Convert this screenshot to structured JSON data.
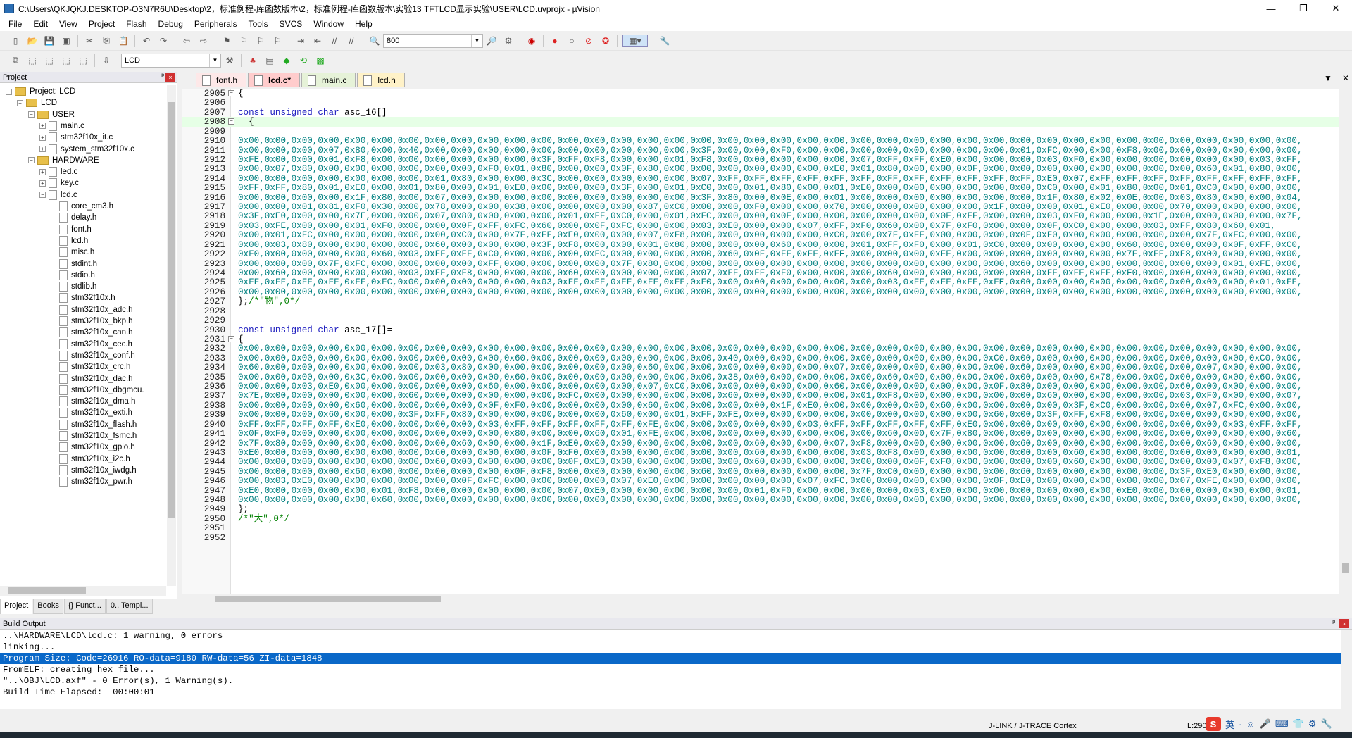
{
  "window": {
    "title": "C:\\Users\\QKJQKJ.DESKTOP-O3N7R6U\\Desktop\\2，标准例程-库函数版本\\2，标准例程-库函数版本\\实验13 TFTLCD显示实验\\USER\\LCD.uvprojx - µVision",
    "minimize": "—",
    "restore": "❐",
    "close": "✕"
  },
  "menu": [
    "File",
    "Edit",
    "View",
    "Project",
    "Flash",
    "Debug",
    "Peripherals",
    "Tools",
    "SVCS",
    "Window",
    "Help"
  ],
  "toolbar": {
    "find_value": "800",
    "target_value": "LCD"
  },
  "project_panel": {
    "title": "Project",
    "pin": "ᵖ",
    "close": "×",
    "tree": [
      {
        "label": "Project: LCD",
        "level": 0,
        "kind": "root",
        "exp": "−"
      },
      {
        "label": "LCD",
        "level": 1,
        "kind": "folder",
        "exp": "−"
      },
      {
        "label": "USER",
        "level": 2,
        "kind": "folder",
        "exp": "−"
      },
      {
        "label": "main.c",
        "level": 3,
        "kind": "file",
        "exp": "+"
      },
      {
        "label": "stm32f10x_it.c",
        "level": 3,
        "kind": "file",
        "exp": "+"
      },
      {
        "label": "system_stm32f10x.c",
        "level": 3,
        "kind": "file",
        "exp": "+"
      },
      {
        "label": "HARDWARE",
        "level": 2,
        "kind": "folder",
        "exp": "−"
      },
      {
        "label": "led.c",
        "level": 3,
        "kind": "file",
        "exp": "+"
      },
      {
        "label": "key.c",
        "level": 3,
        "kind": "file",
        "exp": "+"
      },
      {
        "label": "lcd.c",
        "level": 3,
        "kind": "file",
        "exp": "−"
      },
      {
        "label": "core_cm3.h",
        "level": 4,
        "kind": "file"
      },
      {
        "label": "delay.h",
        "level": 4,
        "kind": "file"
      },
      {
        "label": "font.h",
        "level": 4,
        "kind": "file"
      },
      {
        "label": "lcd.h",
        "level": 4,
        "kind": "file"
      },
      {
        "label": "misc.h",
        "level": 4,
        "kind": "file"
      },
      {
        "label": "stdint.h",
        "level": 4,
        "kind": "file"
      },
      {
        "label": "stdio.h",
        "level": 4,
        "kind": "file"
      },
      {
        "label": "stdlib.h",
        "level": 4,
        "kind": "file"
      },
      {
        "label": "stm32f10x.h",
        "level": 4,
        "kind": "file"
      },
      {
        "label": "stm32f10x_adc.h",
        "level": 4,
        "kind": "file"
      },
      {
        "label": "stm32f10x_bkp.h",
        "level": 4,
        "kind": "file"
      },
      {
        "label": "stm32f10x_can.h",
        "level": 4,
        "kind": "file"
      },
      {
        "label": "stm32f10x_cec.h",
        "level": 4,
        "kind": "file"
      },
      {
        "label": "stm32f10x_conf.h",
        "level": 4,
        "kind": "file"
      },
      {
        "label": "stm32f10x_crc.h",
        "level": 4,
        "kind": "file"
      },
      {
        "label": "stm32f10x_dac.h",
        "level": 4,
        "kind": "file"
      },
      {
        "label": "stm32f10x_dbgmcu.",
        "level": 4,
        "kind": "file"
      },
      {
        "label": "stm32f10x_dma.h",
        "level": 4,
        "kind": "file"
      },
      {
        "label": "stm32f10x_exti.h",
        "level": 4,
        "kind": "file"
      },
      {
        "label": "stm32f10x_flash.h",
        "level": 4,
        "kind": "file"
      },
      {
        "label": "stm32f10x_fsmc.h",
        "level": 4,
        "kind": "file"
      },
      {
        "label": "stm32f10x_gpio.h",
        "level": 4,
        "kind": "file"
      },
      {
        "label": "stm32f10x_i2c.h",
        "level": 4,
        "kind": "file"
      },
      {
        "label": "stm32f10x_iwdg.h",
        "level": 4,
        "kind": "file"
      },
      {
        "label": "stm32f10x_pwr.h",
        "level": 4,
        "kind": "file"
      }
    ],
    "tabs": [
      {
        "label": "Project",
        "active": true
      },
      {
        "label": "Books",
        "active": false
      },
      {
        "label": "{} Funct...",
        "active": false
      },
      {
        "label": "0.. Templ...",
        "active": false
      }
    ]
  },
  "editor": {
    "tabs": [
      "font.h",
      "lcd.c*",
      "main.c",
      "lcd.h"
    ],
    "active_tab": 1,
    "controls": [
      "▼",
      "✕"
    ],
    "lines": [
      {
        "n": "2905",
        "fold": "−",
        "parts": [
          [
            "t",
            "{"
          ]
        ]
      },
      {
        "n": "2906",
        "parts": []
      },
      {
        "n": "2907",
        "parts": [
          [
            "k",
            "const unsigned char"
          ],
          [
            "t",
            " asc_16[]="
          ]
        ]
      },
      {
        "n": "2908",
        "fold": "−",
        "hl": true,
        "parts": [
          [
            "t",
            "  {"
          ]
        ]
      },
      {
        "n": "2909",
        "parts": []
      },
      {
        "n": "2910",
        "parts": [
          [
            "h",
            "0x00,0x00,0x00,0x00,0x00,0x00,0x00,0x00,0x00,0x00,0x00,0x00,0x00,0x00,0x00,0x00,0x00,0x00,0x00,0x00,0x00,0x00,0x00,0x00,0x00,0x00,0x00,0x00,0x00,0x00,0x00,0x00,0x00,0x00,0x00,0x00,0x00,0x00,0x00,0x00,"
          ]
        ]
      },
      {
        "n": "2911",
        "parts": [
          [
            "h",
            "0x00,0x00,0x00,0x07,0x80,0x00,0x40,0x00,0x00,0x00,0x00,0x00,0x00,0x00,0x00,0x00,0x00,0x3F,0x00,0x00,0xF0,0x00,0x00,0x00,0x00,0x00,0x00,0x00,0x00,0x01,0xFC,0x00,0x00,0xF8,0x00,0x00,0x00,0x00,0x00,0x00,"
          ]
        ]
      },
      {
        "n": "2912",
        "parts": [
          [
            "h",
            "0xFE,0x00,0x00,0x01,0xF8,0x00,0x00,0x00,0x00,0x00,0x00,0x3F,0xFF,0xF8,0x00,0x00,0x01,0xF8,0x00,0x00,0x00,0x00,0x00,0x07,0xFF,0xFF,0xE0,0x00,0x00,0x00,0x03,0xF0,0x00,0x00,0x00,0x00,0x00,0x00,0x03,0xFF,"
          ]
        ]
      },
      {
        "n": "2913",
        "parts": [
          [
            "h",
            "0x00,0x07,0x80,0x00,0x00,0x00,0x00,0x00,0x00,0xF0,0x01,0x80,0x00,0x00,0x0F,0x80,0x00,0x00,0x00,0x00,0x00,0x00,0xE0,0x01,0x80,0x00,0x00,0x0F,0x00,0x00,0x00,0x00,0x00,0x00,0x00,0x00,0x60,0x01,0x80,0x00,"
          ]
        ]
      },
      {
        "n": "2914",
        "parts": [
          [
            "h",
            "0x00,0x00,0x00,0x00,0x00,0x00,0x00,0x01,0x80,0x00,0x00,0x3C,0x00,0x00,0x00,0x00,0x00,0x07,0xFF,0xFF,0xFF,0xFF,0xFF,0xFF,0xFF,0xFF,0xFF,0xFF,0xFF,0xFF,0xE0,0x07,0xFF,0xFF,0xFF,0xFF,0xFF,0xFF,0xFF,0xFF,"
          ]
        ]
      },
      {
        "n": "2915",
        "parts": [
          [
            "h",
            "0xFF,0xFF,0x80,0x01,0xE0,0x00,0x01,0x80,0x00,0x01,0xE0,0x00,0x00,0x00,0x3F,0x00,0x01,0xC0,0x00,0x01,0x80,0x00,0x01,0xE0,0x00,0x00,0x00,0x00,0x00,0x00,0xC0,0x00,0x01,0x80,0x00,0x01,0xC0,0x00,0x00,0x00,"
          ]
        ]
      },
      {
        "n": "2916",
        "parts": [
          [
            "h",
            "0x00,0x00,0x00,0x00,0x1F,0x80,0x00,0x07,0x00,0x00,0x00,0x00,0x00,0x00,0x00,0x00,0x00,0x3F,0x80,0x00,0x0E,0x00,0x01,0x00,0x00,0x00,0x00,0x00,0x00,0x00,0x1F,0x80,0x02,0x0E,0x00,0x03,0x80,0x00,0x00,0x04,"
          ]
        ]
      },
      {
        "n": "2917",
        "parts": [
          [
            "h",
            "0x00,0x00,0x01,0x81,0xF0,0x30,0x00,0x78,0x00,0x00,0x38,0x00,0x00,0x00,0x00,0x87,0xC0,0x00,0x00,0xF0,0x00,0x00,0x70,0x00,0x00,0x00,0x00,0x00,0x1F,0x80,0x00,0x01,0xE0,0x00,0x00,0x70,0x00,0x00,0x00,0x00,"
          ]
        ]
      },
      {
        "n": "2918",
        "parts": [
          [
            "h",
            "0x3F,0xE0,0x00,0x00,0x7E,0x00,0x00,0x07,0x80,0x00,0x00,0x00,0x01,0xFF,0xC0,0x00,0x01,0xFC,0x00,0x00,0x0F,0x00,0x00,0x00,0x00,0x00,0x0F,0xFF,0x00,0x00,0x03,0xF0,0x00,0x00,0x1E,0x00,0x00,0x00,0x00,0x7F,"
          ]
        ]
      },
      {
        "n": "2919",
        "parts": [
          [
            "h",
            "0x03,0xFE,0x00,0x00,0x01,0xF0,0x00,0x00,0x0F,0xFF,0xFC,0x60,0x00,0x0F,0xFC,0x00,0x00,0x03,0xE0,0x00,0x00,0x07,0xFF,0xF0,0x60,0x00,0x7F,0xF0,0x00,0x00,0x0F,0xC0,0x00,0x00,0x03,0xFF,0x80,0x60,0x01,"
          ]
        ]
      },
      {
        "n": "2920",
        "parts": [
          [
            "h",
            "0x00,0x01,0xFC,0x00,0x00,0x00,0x00,0x00,0xC0,0x00,0x7F,0xFF,0xE0,0x00,0x00,0x07,0xF8,0x00,0x00,0x00,0x00,0x00,0xC0,0x00,0x7F,0xFF,0x00,0x00,0x00,0x0F,0xF0,0x00,0x00,0x00,0x00,0x00,0x7F,0xFC,0x00,0x00,"
          ]
        ]
      },
      {
        "n": "2921",
        "parts": [
          [
            "h",
            "0x00,0x03,0x80,0x00,0x00,0x00,0x00,0x60,0x00,0x00,0x00,0x3F,0xF8,0x00,0x00,0x01,0x80,0x00,0x00,0x00,0x60,0x00,0x00,0x01,0xFF,0xF0,0x00,0x01,0xC0,0x00,0x00,0x00,0x00,0x60,0x00,0x00,0x00,0x0F,0xFF,0xC0,"
          ]
        ]
      },
      {
        "n": "2922",
        "parts": [
          [
            "h",
            "0xF0,0x00,0x00,0x00,0x00,0x60,0x03,0xFF,0xFF,0xC0,0x00,0x00,0x00,0xFC,0x00,0x00,0x00,0x00,0x60,0x0F,0xFF,0xFF,0xFE,0x00,0x00,0x00,0xFF,0x00,0x00,0x00,0x00,0x00,0x00,0x7F,0xFF,0xF8,0x00,0x00,0x00,0x00,"
          ]
        ]
      },
      {
        "n": "2923",
        "parts": [
          [
            "h",
            "0x00,0x00,0x00,0x7F,0xFC,0x00,0x00,0x00,0x00,0xFF,0x00,0x00,0x00,0x00,0x7F,0x80,0x00,0x00,0x00,0x00,0x00,0x00,0x00,0x00,0x00,0x00,0x00,0x00,0x00,0x60,0x00,0x00,0x00,0x00,0x00,0x00,0x00,0x01,0xFE,0x00,"
          ]
        ]
      },
      {
        "n": "2924",
        "parts": [
          [
            "h",
            "0x00,0x60,0x00,0x00,0x00,0x00,0x03,0xFF,0xF8,0x00,0x00,0x00,0x60,0x00,0x00,0x00,0x00,0x07,0xFF,0xFF,0xF0,0x00,0x00,0x00,0x60,0x00,0x00,0x00,0x00,0x00,0xFF,0xFF,0xFF,0xE0,0x00,0x00,0x00,0x00,0x00,0x00,"
          ]
        ]
      },
      {
        "n": "2925",
        "parts": [
          [
            "h",
            "0xFF,0xFF,0xFF,0xFF,0xFF,0xFC,0x00,0x00,0x00,0x00,0x00,0x03,0xFF,0xFF,0xFF,0xFF,0xFF,0xF0,0x00,0x00,0x00,0x00,0x00,0x00,0x03,0xFF,0xFF,0xFF,0xFE,0x00,0x00,0x00,0x00,0x00,0x00,0x00,0x00,0x00,0x01,0xFF,"
          ]
        ]
      },
      {
        "n": "2926",
        "parts": [
          [
            "h",
            "0x00,0x00,0x00,0x00,0x00,0x00,0x00,0x00,0x00,0x00,0x00,0x00,0x00,0x00,0x00,0x00,0x00,0x00,0x00,0x00,0x00,0x00,0x00,0x00,0x00,0x00,0x00,0x00,0x00,0x00,0x00,0x00,0x00,0x00,0x00,0x00,0x00,0x00,0x00,0x00,"
          ]
        ]
      },
      {
        "n": "2927",
        "parts": [
          [
            "t",
            "};"
          ],
          [
            "c",
            "/*\"物\",0*/"
          ]
        ]
      },
      {
        "n": "2928",
        "parts": []
      },
      {
        "n": "2929",
        "parts": []
      },
      {
        "n": "2930",
        "parts": [
          [
            "k",
            "const unsigned char"
          ],
          [
            "t",
            " asc_17[]="
          ]
        ]
      },
      {
        "n": "2931",
        "fold": "−",
        "parts": [
          [
            "t",
            "{"
          ]
        ]
      },
      {
        "n": "2932",
        "parts": [
          [
            "h",
            "0x00,0x00,0x00,0x00,0x00,0x00,0x00,0x00,0x00,0x00,0x00,0x00,0x00,0x00,0x00,0x00,0x00,0x00,0x00,0x00,0x00,0x00,0x00,0x00,0x00,0x00,0x00,0x00,0x00,0x00,0x00,0x00,0x00,0x00,0x00,0x00,0x00,0x00,0x00,0x00,"
          ]
        ]
      },
      {
        "n": "2933",
        "parts": [
          [
            "h",
            "0x00,0x00,0x00,0x00,0x00,0x00,0x00,0x00,0x00,0x00,0x60,0x00,0x00,0x00,0x00,0x00,0x00,0x00,0x40,0x00,0x00,0x00,0x00,0x00,0x00,0x00,0x00,0x00,0xC0,0x00,0x00,0x00,0x00,0x00,0x00,0x00,0x00,0x00,0xC0,0x00,"
          ]
        ]
      },
      {
        "n": "2934",
        "parts": [
          [
            "h",
            "0x60,0x00,0x00,0x00,0x00,0x00,0x00,0x03,0x80,0x00,0x00,0x00,0x00,0x00,0x00,0x60,0x00,0x00,0x00,0x00,0x00,0x00,0x07,0x00,0x00,0x00,0x00,0x00,0x00,0x60,0x00,0x00,0x00,0x00,0x00,0x00,0x07,0x00,0x00,0x00,"
          ]
        ]
      },
      {
        "n": "2935",
        "parts": [
          [
            "h",
            "0x00,0x00,0x00,0x00,0x3C,0x00,0x00,0x00,0x00,0x00,0x60,0x00,0x00,0x00,0x00,0x00,0x00,0x00,0x38,0x00,0x00,0x00,0x00,0x00,0x60,0x00,0x00,0x00,0x00,0x00,0x00,0x00,0x78,0x00,0x00,0x00,0x00,0x00,0x60,0x00,"
          ]
        ]
      },
      {
        "n": "2936",
        "parts": [
          [
            "h",
            "0x00,0x00,0x03,0xE0,0x00,0x00,0x00,0x00,0x00,0x60,0x00,0x00,0x00,0x00,0x00,0x07,0xC0,0x00,0x00,0x00,0x00,0x00,0x60,0x00,0x00,0x00,0x00,0x00,0x0F,0x80,0x00,0x00,0x00,0x00,0x00,0x60,0x00,0x00,0x00,0x00,"
          ]
        ]
      },
      {
        "n": "2937",
        "parts": [
          [
            "h",
            "0x7E,0x00,0x00,0x00,0x00,0x00,0x60,0x00,0x00,0x00,0x00,0x00,0xFC,0x00,0x00,0x00,0x00,0x00,0x60,0x00,0x00,0x00,0x00,0x01,0xF8,0x00,0x00,0x00,0x00,0x00,0x60,0x00,0x00,0x00,0x00,0x03,0xF0,0x00,0x00,0x07,"
          ]
        ]
      },
      {
        "n": "2938",
        "parts": [
          [
            "h",
            "0x00,0x00,0x00,0x00,0x60,0x00,0x00,0x00,0x00,0x0F,0xF0,0x00,0x00,0x00,0x00,0x60,0x00,0x00,0x00,0x00,0x1F,0xE0,0x00,0x00,0x00,0x00,0x60,0x00,0x00,0x00,0x00,0x3F,0xC0,0x00,0x00,0x00,0x07,0xFC,0x00,0x00,"
          ]
        ]
      },
      {
        "n": "2939",
        "parts": [
          [
            "h",
            "0x00,0x00,0x00,0x60,0x00,0x00,0x3F,0xFF,0x80,0x00,0x00,0x00,0x00,0x00,0x60,0x00,0x01,0xFF,0xFE,0x00,0x00,0x00,0x00,0x00,0x00,0x00,0x00,0x00,0x60,0x00,0x3F,0xFF,0xF8,0x00,0x00,0x00,0x00,0x00,0x00,0x00,"
          ]
        ]
      },
      {
        "n": "2940",
        "parts": [
          [
            "h",
            "0xFF,0xFF,0xFF,0xFF,0xE0,0x00,0x00,0x00,0x00,0x03,0xFF,0xFF,0xFF,0xFF,0xFF,0xFE,0x00,0x00,0x00,0x00,0x00,0x03,0xFF,0xFF,0xFF,0xFF,0xFF,0xE0,0x00,0x00,0x00,0x00,0x00,0x00,0x00,0x00,0x00,0x03,0xFF,0xFF,"
          ]
        ]
      },
      {
        "n": "2941",
        "parts": [
          [
            "h",
            "0x0F,0xF0,0x00,0x00,0x00,0x00,0x00,0x00,0x00,0x00,0x80,0x00,0x00,0x60,0x01,0xFE,0x00,0x00,0x00,0x00,0x00,0x00,0x00,0x00,0x60,0x00,0x7F,0x80,0x00,0x00,0x00,0x00,0x00,0x00,0x00,0x00,0x00,0x00,0x00,0x60,"
          ]
        ]
      },
      {
        "n": "2942",
        "parts": [
          [
            "h",
            "0x7F,0x80,0x00,0x00,0x00,0x00,0x00,0x00,0x60,0x00,0x00,0x1F,0xE0,0x00,0x00,0x00,0x00,0x00,0x00,0x60,0x00,0x00,0x07,0xF8,0x00,0x00,0x00,0x00,0x00,0x60,0x00,0x00,0x00,0x00,0x00,0x00,0x60,0x00,0x00,0x00,"
          ]
        ]
      },
      {
        "n": "2943",
        "parts": [
          [
            "h",
            "0xE0,0x00,0x00,0x00,0x00,0x00,0x00,0x60,0x00,0x00,0x00,0x0F,0xF0,0x00,0x00,0x00,0x00,0x00,0x00,0x60,0x00,0x00,0x00,0x03,0xF8,0x00,0x00,0x00,0x00,0x00,0x00,0x60,0x00,0x00,0x00,0x00,0x00,0x00,0x00,0x01,"
          ]
        ]
      },
      {
        "n": "2944",
        "parts": [
          [
            "h",
            "0x00,0x00,0x00,0x00,0x00,0x00,0x00,0x60,0x00,0x00,0x00,0x00,0x0F,0xE0,0x00,0x00,0x00,0x00,0x00,0x60,0x00,0x00,0x00,0x00,0x00,0x0F,0xF0,0x00,0x00,0x00,0x00,0x60,0x00,0x00,0x00,0x00,0x00,0x07,0xF8,0x00,"
          ]
        ]
      },
      {
        "n": "2945",
        "parts": [
          [
            "h",
            "0x00,0x00,0x00,0x00,0x60,0x00,0x00,0x00,0x00,0x00,0x0F,0xF8,0x00,0x00,0x00,0x00,0x00,0x60,0x00,0x00,0x00,0x00,0x00,0x7F,0xC0,0x00,0x00,0x00,0x00,0x60,0x00,0x00,0x00,0x00,0x00,0x3F,0xE0,0x00,0x00,0x00,"
          ]
        ]
      },
      {
        "n": "2946",
        "parts": [
          [
            "h",
            "0x00,0x03,0xE0,0x00,0x00,0x00,0x00,0x00,0x0F,0xFC,0x00,0x00,0x00,0x00,0x07,0xE0,0x00,0x00,0x00,0x00,0x00,0x07,0xFC,0x00,0x00,0x00,0x00,0x00,0x0F,0xE0,0x00,0x00,0x00,0x00,0x00,0x07,0xFE,0x00,0x00,0x00,"
          ]
        ]
      },
      {
        "n": "2947",
        "parts": [
          [
            "h",
            "0xE0,0x00,0x00,0x00,0x00,0x01,0xF8,0x00,0x00,0x00,0x00,0x00,0x07,0xE0,0x00,0x00,0x00,0x00,0x00,0x01,0xF0,0x00,0x00,0x00,0x00,0x03,0xE0,0x00,0x00,0x00,0x00,0x00,0x00,0xE0,0x00,0x00,0x00,0x00,0x00,0x01,"
          ]
        ]
      },
      {
        "n": "2948",
        "parts": [
          [
            "h",
            "0x00,0x00,0x00,0x00,0x00,0x60,0x00,0x00,0x00,0x00,0x00,0x00,0x00,0x00,0x00,0x00,0x00,0x00,0x00,0x00,0x00,0x00,0x00,0x00,0x00,0x00,0x00,0x00,0x00,0x00,0x00,0x00,0x00,0x00,0x00,0x00,0x00,0x00,0x00,0x00,"
          ]
        ]
      },
      {
        "n": "2949",
        "parts": [
          [
            "t",
            "};"
          ]
        ]
      },
      {
        "n": "2950",
        "parts": [
          [
            "c",
            "/*\"大\",0*/"
          ]
        ]
      },
      {
        "n": "2951",
        "parts": []
      },
      {
        "n": "2952",
        "parts": []
      }
    ]
  },
  "build_output": {
    "title": "Build Output",
    "lines": [
      "..\\HARDWARE\\LCD\\lcd.c: 1 warning, 0 errors",
      "linking...",
      "Program Size: Code=26916 RO-data=9180 RW-data=56 ZI-data=1848",
      "FromELF: creating hex file...",
      "\"..\\OBJ\\LCD.axf\" - 0 Error(s), 1 Warning(s).",
      "Build Time Elapsed:  00:00:01"
    ],
    "selected_line": 2
  },
  "status": {
    "debugger": "J-LINK / J-TRACE Cortex",
    "position": "L:2908"
  },
  "tray": [
    "S",
    "英",
    "·",
    "☺",
    "🎤",
    "⌨",
    "👕",
    "⚙",
    "🔧"
  ]
}
